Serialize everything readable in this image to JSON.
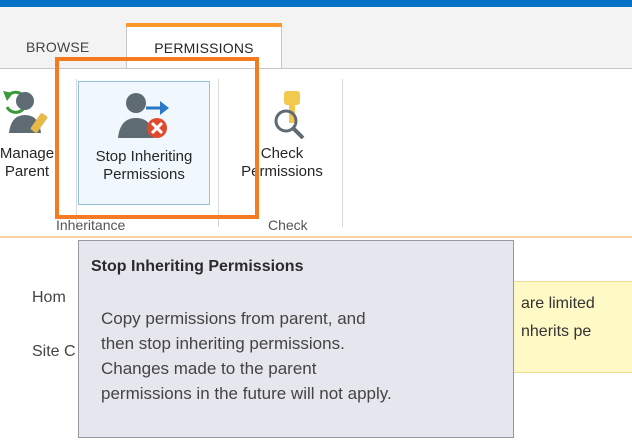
{
  "tabs": {
    "browse": "BROWSE",
    "permissions": "PERMISSIONS"
  },
  "ribbon": {
    "manage_parent": "Manage Parent",
    "stop_inheriting": "Stop Inheriting Permissions",
    "check_permissions": "Check Permissions",
    "group_inheritance": "Inheritance",
    "group_check": "Check"
  },
  "content": {
    "home_link": "Hom",
    "site_link": "Site C",
    "notice_line1": "are limited",
    "notice_line2": "nherits pe"
  },
  "tooltip": {
    "title": "Stop Inheriting Permissions",
    "body": "Copy permissions from parent, and\nthen stop inheriting permissions.\nChanges made to the parent\npermissions in the future will not apply."
  },
  "colors": {
    "top_bar": "#0072c6",
    "highlight": "#f47b20",
    "tab_accent": "#f8972c",
    "notice_bg": "#fff9c6",
    "tooltip_bg": "#e6e6ee"
  }
}
